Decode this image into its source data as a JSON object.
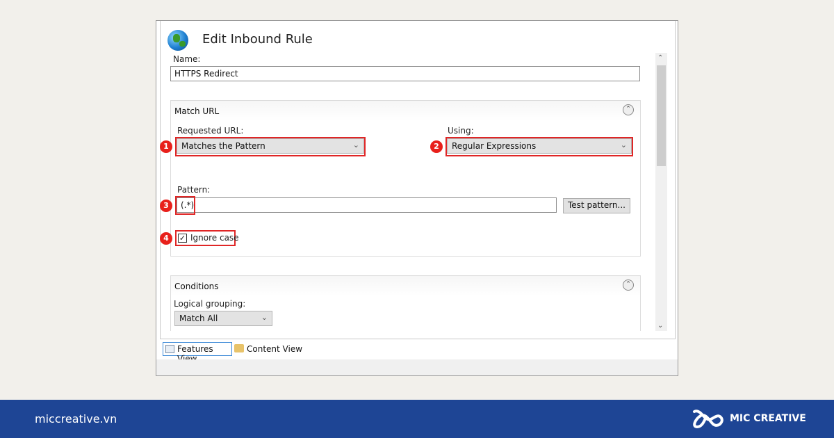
{
  "window": {
    "title": "Edit Inbound Rule"
  },
  "name_field": {
    "label": "Name:",
    "value": "HTTPS Redirect"
  },
  "match_url": {
    "header": "Match URL",
    "requested_url_label": "Requested URL:",
    "requested_url_value": "Matches the Pattern",
    "using_label": "Using:",
    "using_value": "Regular Expressions",
    "pattern_label": "Pattern:",
    "pattern_value": "(.*)",
    "test_pattern_label": "Test pattern...",
    "ignore_case_label": "Ignore case",
    "ignore_case_checked": true
  },
  "conditions": {
    "header": "Conditions",
    "logical_grouping_label": "Logical grouping:",
    "logical_grouping_value": "Match All"
  },
  "bottom_tabs": [
    {
      "label": "Features View",
      "active": true
    },
    {
      "label": "Content View",
      "active": false
    }
  ],
  "badges": [
    "1",
    "2",
    "3",
    "4"
  ],
  "highlight_color": "#e02626",
  "footer": {
    "website": "miccreative.vn",
    "brand": "MIC CREATIVE",
    "color": "#1e4595"
  }
}
